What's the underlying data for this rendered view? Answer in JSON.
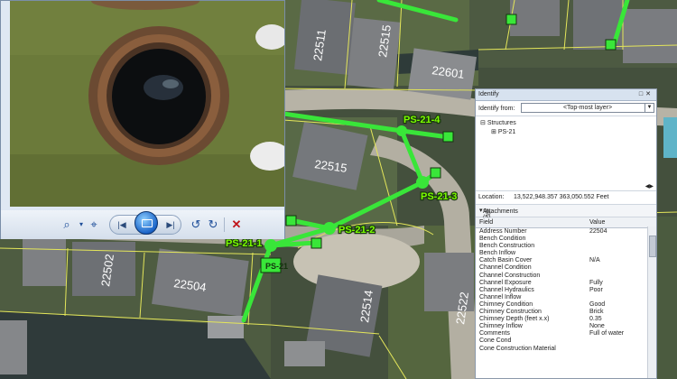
{
  "map": {
    "parcels": [
      {
        "label": "22511"
      },
      {
        "label": "22515"
      },
      {
        "label": "22601"
      },
      {
        "label": "22515"
      },
      {
        "label": "22502"
      },
      {
        "label": "22504"
      },
      {
        "label": "22514"
      },
      {
        "label": "22522"
      }
    ],
    "structures": [
      {
        "label": "PS-21-4"
      },
      {
        "label": "PS-21-3"
      },
      {
        "label": "PS-21-2"
      },
      {
        "label": "PS-21-1"
      },
      {
        "label": "PS-21"
      }
    ],
    "colors": {
      "pipe": "#39e639",
      "parcel_line": "#e4e65a",
      "pavement": "#bcb8ac"
    }
  },
  "viewer": {
    "tools": [
      "zoom-icon",
      "fit-icon",
      "previous-icon",
      "slideshow-icon",
      "next-icon",
      "rotate-ccw-icon",
      "rotate-cw-icon",
      "delete-icon"
    ]
  },
  "identify": {
    "title": "Identify",
    "identify_from_label": "Identify from:",
    "identify_from_value": "<Top-most layer>",
    "tree_root": "Structures",
    "tree_child": "PS-21",
    "location_label": "Location:",
    "location_value": "13,522,948.357  363,050.552 Feet",
    "attachments_label": "Attachments (5)",
    "col_field": "Field",
    "col_value": "Value",
    "fields": [
      {
        "name": "Address Number",
        "value": "22504"
      },
      {
        "name": "Bench Condition",
        "value": ""
      },
      {
        "name": "Bench Construction",
        "value": ""
      },
      {
        "name": "Bench Inflow",
        "value": ""
      },
      {
        "name": "Catch Basin Cover",
        "value": "N/A"
      },
      {
        "name": "Channel Condition",
        "value": ""
      },
      {
        "name": "Channel Construction",
        "value": ""
      },
      {
        "name": "Channel Exposure",
        "value": "Fully"
      },
      {
        "name": "Channel Hydraulics",
        "value": "Poor"
      },
      {
        "name": "Channel Inflow",
        "value": ""
      },
      {
        "name": "Chimney Condition",
        "value": "Good"
      },
      {
        "name": "Chimney Construction",
        "value": "Brick"
      },
      {
        "name": "Chimney Depth (feet x.x)",
        "value": "0.35"
      },
      {
        "name": "Chimney Inflow",
        "value": "None"
      },
      {
        "name": "Comments",
        "value": "Full of water"
      },
      {
        "name": "Cone Cond",
        "value": ""
      },
      {
        "name": "Cone Construction Material",
        "value": ""
      }
    ]
  }
}
